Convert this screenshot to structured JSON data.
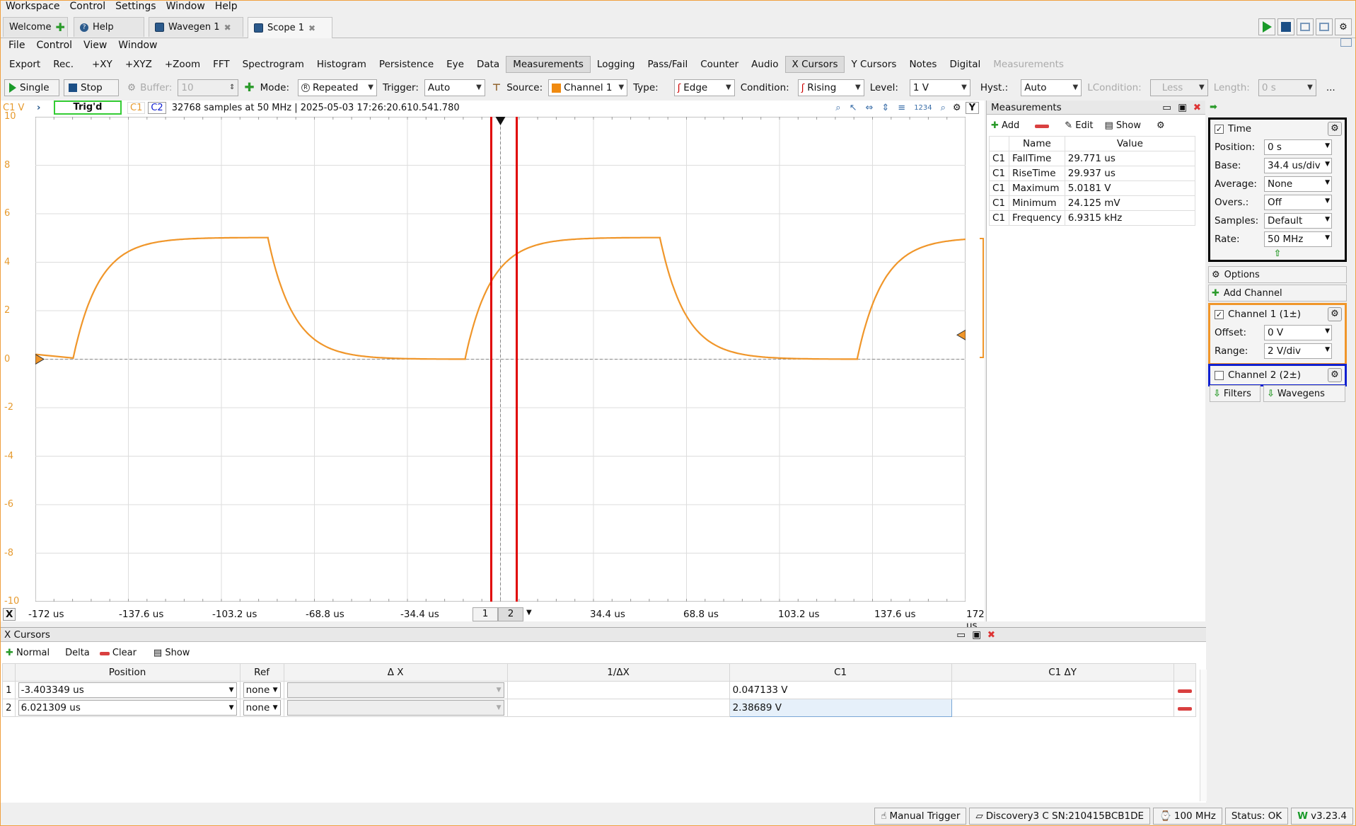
{
  "menu": [
    "Workspace",
    "Control",
    "Settings",
    "Window",
    "Help"
  ],
  "tabs": [
    {
      "label": "Welcome",
      "icon": "plus-icon"
    },
    {
      "label": "Help",
      "icon": "help-icon"
    },
    {
      "label": "Wavegen 1",
      "icon": "wavegen-icon"
    },
    {
      "label": "Scope 1",
      "icon": "scope-icon"
    }
  ],
  "menu2": [
    "File",
    "Control",
    "View",
    "Window"
  ],
  "toolbar": [
    "Export",
    "Rec.",
    "+XY",
    "+XYZ",
    "+Zoom",
    "FFT",
    "Spectrogram",
    "Histogram",
    "Persistence",
    "Eye",
    "Data",
    "Measurements",
    "Logging",
    "Pass/Fail",
    "Counter",
    "Audio",
    "X Cursors",
    "Y Cursors",
    "Notes",
    "Digital",
    "Measurements"
  ],
  "ctrl": {
    "single": "Single",
    "stop": "Stop",
    "buffer_label": "Buffer:",
    "buffer_value": "10",
    "mode_label": "Mode:",
    "mode_value": "Repeated",
    "trigger_label": "Trigger:",
    "trigger_value": "Auto",
    "source_label": "Source:",
    "source_value": "Channel 1",
    "type_label": "Type:",
    "type_value": "Edge",
    "condition_label": "Condition:",
    "condition_value": "Rising",
    "level_label": "Level:",
    "level_value": "1 V",
    "hyst_label": "Hyst.:",
    "hyst_value": "Auto",
    "lcond_label": "LCondition:",
    "lcond_value": "Less",
    "length_label": "Length:",
    "length_value": "0 s",
    "more": "..."
  },
  "plot": {
    "unit_label": "C1 V",
    "status": "Trig'd",
    "c1": "C1",
    "c2": "C2",
    "info": "32768 samples at 50 MHz  | 2025-05-03 17:26:20.610.541.780",
    "y_ticks": [
      "10",
      "8",
      "6",
      "4",
      "2",
      "0",
      "-2",
      "-4",
      "-6",
      "-8",
      "-10"
    ],
    "x_ticks": [
      "-172 us",
      "-137.6 us",
      "-103.2 us",
      "-68.8 us",
      "-34.4 us",
      "34.4 us",
      "68.8 us",
      "103.2 us",
      "137.6 us",
      "172 us"
    ],
    "cursor_tabs": [
      "1",
      "2"
    ],
    "x_btn": "X",
    "y_btn": "Y",
    "trace_color": "#f0962a",
    "cursor_color": "#e00000"
  },
  "chart_data": {
    "type": "line",
    "xlabel": "",
    "ylabel": "C1 V",
    "xlim": [
      -172,
      172
    ],
    "ylim": [
      -10,
      10
    ],
    "series": [
      {
        "x": [
          -172,
          -158,
          -150,
          -140,
          -130,
          -120,
          -110,
          -100,
          -90,
          -80,
          -68,
          -62,
          -55,
          -45,
          -35,
          -25,
          -15,
          -5,
          0,
          5,
          15,
          25,
          35,
          45,
          55,
          68,
          74,
          80,
          90,
          100,
          110,
          120,
          130,
          140,
          150,
          152,
          160,
          172
        ],
        "values": [
          0.2,
          0.05,
          0.1,
          1.8,
          3.2,
          4.1,
          4.6,
          4.85,
          4.95,
          5.0,
          5.02,
          4.0,
          2.6,
          1.2,
          0.55,
          0.25,
          0.1,
          0.05,
          1.8,
          2.8,
          3.8,
          4.4,
          4.75,
          4.9,
          4.98,
          5.02,
          4.0,
          2.7,
          1.4,
          0.65,
          0.3,
          0.12,
          0.06,
          0.05,
          0.05,
          0.2,
          2.5,
          4.6
        ]
      }
    ]
  },
  "measurements": {
    "title": "Measurements",
    "add": "Add",
    "edit": "Edit",
    "show": "Show",
    "headers": [
      "Name",
      "Value"
    ],
    "rows": [
      {
        "ch": "C1",
        "name": "FallTime",
        "value": "29.771 us"
      },
      {
        "ch": "C1",
        "name": "RiseTime",
        "value": "29.937 us"
      },
      {
        "ch": "C1",
        "name": "Maximum",
        "value": "5.0181 V"
      },
      {
        "ch": "C1",
        "name": "Minimum",
        "value": "24.125 mV"
      },
      {
        "ch": "C1",
        "name": "Frequency",
        "value": "6.9315 kHz"
      }
    ]
  },
  "time": {
    "title": "Time",
    "rows": [
      {
        "k": "Position:",
        "v": "0 s"
      },
      {
        "k": "Base:",
        "v": "34.4 us/div"
      },
      {
        "k": "Average:",
        "v": "None"
      },
      {
        "k": "Overs.:",
        "v": "Off"
      },
      {
        "k": "Samples:",
        "v": "Default"
      },
      {
        "k": "Rate:",
        "v": "50 MHz"
      }
    ]
  },
  "options": "Options",
  "add_channel": "Add Channel",
  "ch1": {
    "title": "Channel 1 (1±)",
    "offset_label": "Offset:",
    "offset": "0 V",
    "range_label": "Range:",
    "range": "2 V/div",
    "color": "#f0962a"
  },
  "ch2": {
    "title": "Channel 2 (2±)",
    "color": "#1020d0"
  },
  "filters": "Filters",
  "wavegens": "Wavegens",
  "xcursors": {
    "title": "X Cursors",
    "normal": "Normal",
    "delta": "Delta",
    "clear": "Clear",
    "show": "Show",
    "headers": [
      "Position",
      "Ref",
      "Δ X",
      "1/ΔX",
      "C1",
      "C1 ΔY"
    ],
    "rows": [
      {
        "n": "1",
        "pos": "-3.403349 us",
        "ref": "none",
        "c1": "0.047133 V"
      },
      {
        "n": "2",
        "pos": "6.021309 us",
        "ref": "none",
        "c1": "2.38689 V"
      }
    ]
  },
  "status": {
    "manual": "Manual Trigger",
    "device": "Discovery3 C SN:210415BCB1DE",
    "clock": "100 MHz",
    "status": "Status: OK",
    "version": "v3.23.4"
  }
}
